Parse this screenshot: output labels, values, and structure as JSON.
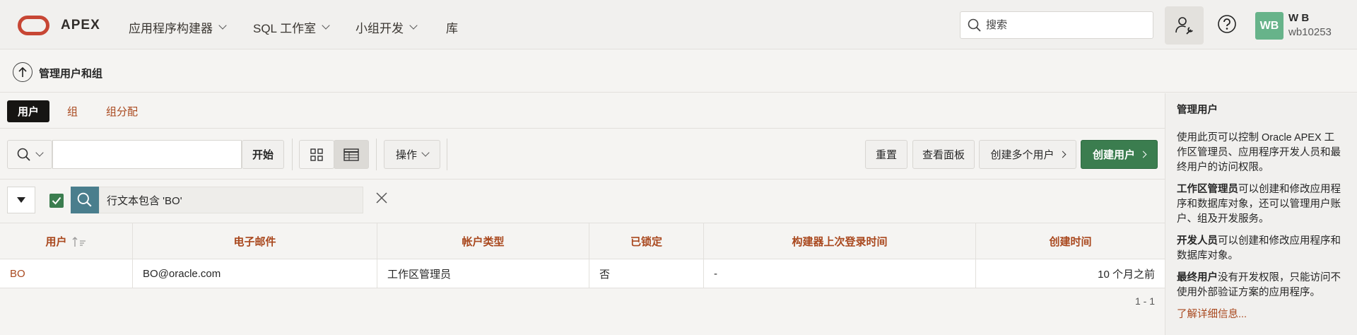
{
  "header": {
    "logo_text": "APEX",
    "nav": [
      {
        "label": "应用程序构建器",
        "has_menu": true
      },
      {
        "label": "SQL 工作室",
        "has_menu": true
      },
      {
        "label": "小组开发",
        "has_menu": true
      },
      {
        "label": "库",
        "has_menu": false
      }
    ],
    "search_placeholder": "搜索",
    "user": {
      "initials": "WB",
      "name": "W B",
      "id": "wb10253"
    }
  },
  "breadcrumb": {
    "title": "管理用户和组"
  },
  "tabs": [
    {
      "label": "用户",
      "active": true
    },
    {
      "label": "组",
      "active": false
    },
    {
      "label": "组分配",
      "active": false
    }
  ],
  "toolbar": {
    "go_label": "开始",
    "actions_label": "操作",
    "reset_label": "重置",
    "view_dashboard_label": "查看面板",
    "create_multiple_label": "创建多个用户",
    "create_user_label": "创建用户"
  },
  "filter": {
    "text": "行文本包含 'BO'",
    "enabled": true
  },
  "table": {
    "columns": [
      "用户",
      "电子邮件",
      "帐户类型",
      "已锁定",
      "构建器上次登录时间",
      "创建时间"
    ],
    "rows": [
      {
        "user": "BO",
        "email": "BO@oracle.com",
        "account_type": "工作区管理员",
        "locked": "否",
        "last_login": "-",
        "created": "10 个月之前"
      }
    ],
    "pagination": "1 - 1"
  },
  "aside": {
    "title": "管理用户",
    "intro": "使用此页可以控制 Oracle APEX 工作区管理员、应用程序开发人员和最终用户的访问权限。",
    "admin_term": "工作区管理员",
    "admin_desc": "可以创建和修改应用程序和数据库对象，还可以管理用户账户、组及开发服务。",
    "dev_term": "开发人员",
    "dev_desc": "可以创建和修改应用程序和数据库对象。",
    "end_term": "最终用户",
    "end_desc": "没有开发权限，只能访问不使用外部验证方案的应用程序。",
    "more_link": "了解详细信息..."
  },
  "colors": {
    "accent": "#a9481e",
    "brand": "#c74634",
    "primary_button": "#3b7d4f",
    "avatar": "#67b38a"
  }
}
